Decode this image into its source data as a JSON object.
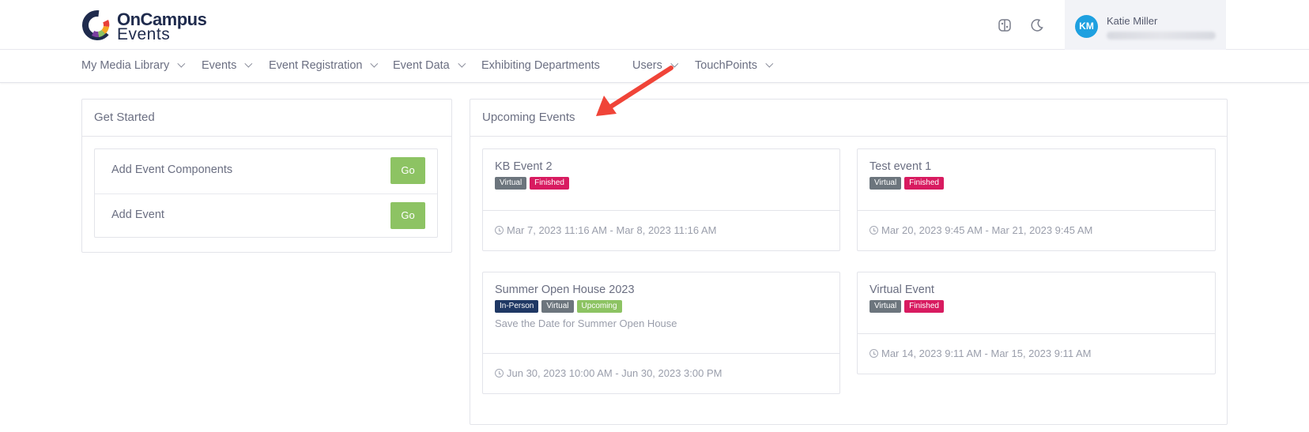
{
  "header": {
    "logo_line1": "OnCampus",
    "logo_line2": "Events",
    "user": {
      "initials": "KM",
      "name": "Katie Miller"
    }
  },
  "nav": {
    "items": [
      {
        "label": "My Media Library",
        "dropdown": true
      },
      {
        "label": "Events",
        "dropdown": true
      },
      {
        "label": "Event Registration",
        "dropdown": true
      },
      {
        "label": "Event Data",
        "dropdown": true
      },
      {
        "label": "Exhibiting Departments",
        "dropdown": false
      },
      {
        "label": "Users",
        "dropdown": true
      },
      {
        "label": "TouchPoints",
        "dropdown": true
      }
    ]
  },
  "get_started": {
    "title": "Get Started",
    "items": [
      {
        "label": "Add Event Components",
        "button": "Go"
      },
      {
        "label": "Add Event",
        "button": "Go"
      }
    ]
  },
  "upcoming": {
    "title": "Upcoming Events",
    "events": [
      {
        "title": "KB Event 2",
        "badges": [
          "Virtual",
          "Finished"
        ],
        "description": "",
        "time": "Mar 7, 2023 11:16 AM - Mar 8, 2023 11:16 AM"
      },
      {
        "title": "Test event 1",
        "badges": [
          "Virtual",
          "Finished"
        ],
        "description": "",
        "time": "Mar 20, 2023 9:45 AM - Mar 21, 2023 9:45 AM"
      },
      {
        "title": "Summer Open House 2023",
        "badges": [
          "In-Person",
          "Virtual",
          "Upcoming"
        ],
        "description": "Save the Date for Summer Open House",
        "time": "Jun 30, 2023 10:00 AM - Jun 30, 2023 3:00 PM"
      },
      {
        "title": "Virtual Event",
        "badges": [
          "Virtual",
          "Finished"
        ],
        "description": "",
        "time": "Mar 14, 2023 9:11 AM - Mar 15, 2023 9:11 AM"
      }
    ]
  },
  "colors": {
    "go_button": "#8dc363",
    "badge_virtual": "#6c757d",
    "badge_finished": "#d81b60",
    "badge_inperson": "#1f3864",
    "badge_upcoming": "#8dc363",
    "avatar": "#1ea0e0",
    "annotation_arrow": "#f04438"
  },
  "icons": [
    "oncampus-logo-icon",
    "app-switch-icon",
    "moon-icon",
    "chevron-down-icon",
    "clock-icon",
    "annotation-arrow-icon"
  ]
}
